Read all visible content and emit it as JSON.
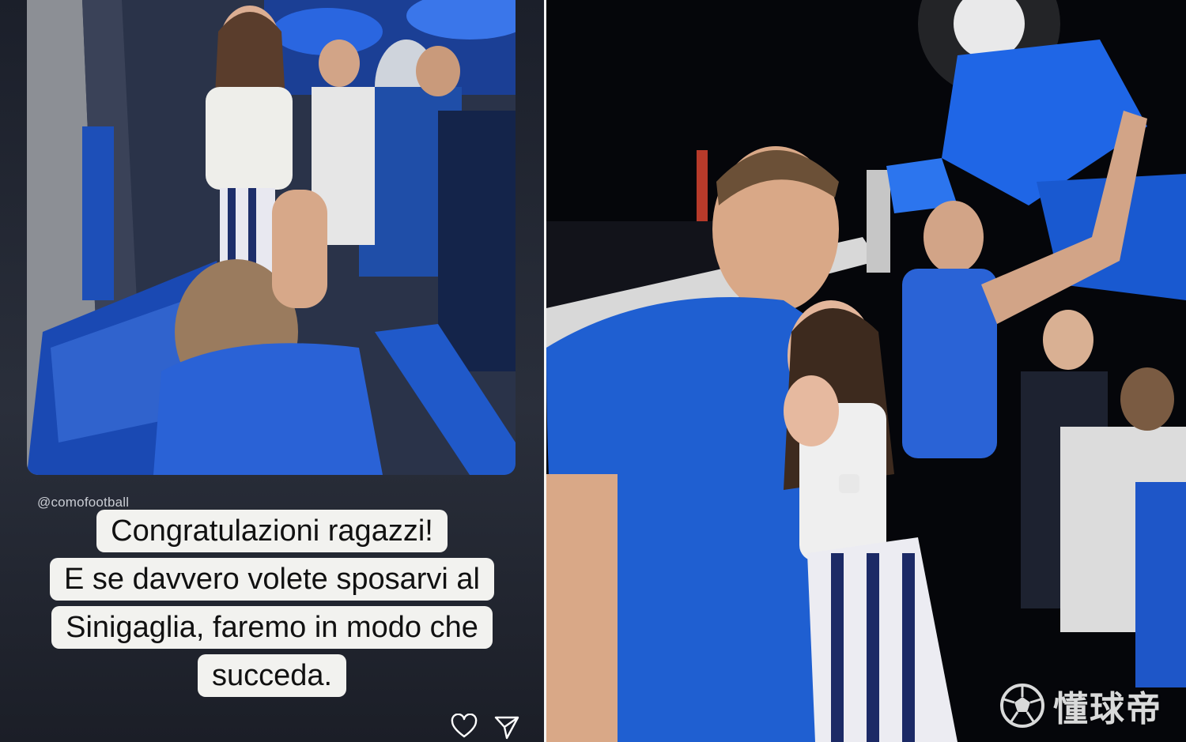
{
  "story": {
    "repost_handle": "@comofootball",
    "caption_lines": [
      "Congratulazioni ragazzi!",
      "E se davvero volete sposarvi al",
      "Sinigaglia, faremo in modo che",
      "succeda."
    ],
    "actions": [
      "heart-icon",
      "send-icon"
    ]
  },
  "watermark": {
    "text": "懂球帝",
    "logo_icon": "soccer-ball-icon"
  },
  "colors": {
    "como_blue": "#1f5fd1",
    "caption_bg": "#f2f2ef",
    "caption_text": "#111111"
  }
}
